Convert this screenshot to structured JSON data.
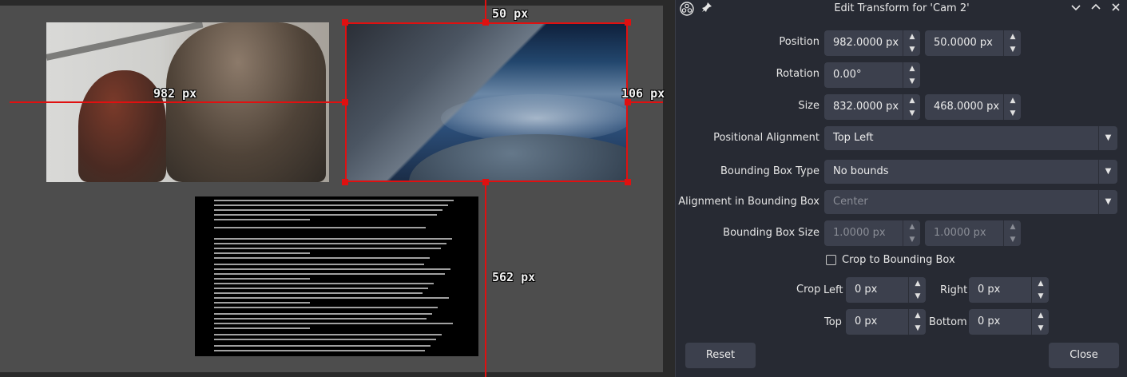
{
  "preview": {
    "labels": {
      "top": "50 px",
      "left": "982 px",
      "right": "106 px",
      "bottom": "562 px"
    }
  },
  "dialog": {
    "title": "Edit Transform for 'Cam 2'",
    "icons": [
      "obs-logo-icon",
      "pin-icon",
      "chevron-down-icon",
      "chevron-up-icon",
      "close-icon"
    ],
    "position": {
      "label": "Position",
      "x": "982.0000 px",
      "y": "50.0000 px"
    },
    "rotation": {
      "label": "Rotation",
      "value": "0.00°"
    },
    "size": {
      "label": "Size",
      "width": "832.0000 px",
      "height": "468.0000 px"
    },
    "positional_alignment": {
      "label": "Positional Alignment",
      "value": "Top Left"
    },
    "bounding_box_type": {
      "label": "Bounding Box Type",
      "value": "No bounds"
    },
    "alignment_in_bounding_box": {
      "label": "Alignment in Bounding Box",
      "value": "Center"
    },
    "bounding_box_size": {
      "label": "Bounding Box Size",
      "width": "1.0000 px",
      "height": "1.0000 px"
    },
    "crop_to_bounding_box": {
      "label": "Crop to Bounding Box",
      "checked": false
    },
    "crop": {
      "label": "Crop",
      "left_label": "Left",
      "left": "0 px",
      "right_label": "Right",
      "right": "0 px",
      "top_label": "Top",
      "top": "0 px",
      "bottom_label": "Bottom",
      "bottom": "0 px"
    },
    "reset_label": "Reset",
    "close_label": "Close"
  },
  "colors": {
    "guide": "#e01010",
    "panel_bg": "#272a33",
    "field_bg": "#3c404d"
  }
}
